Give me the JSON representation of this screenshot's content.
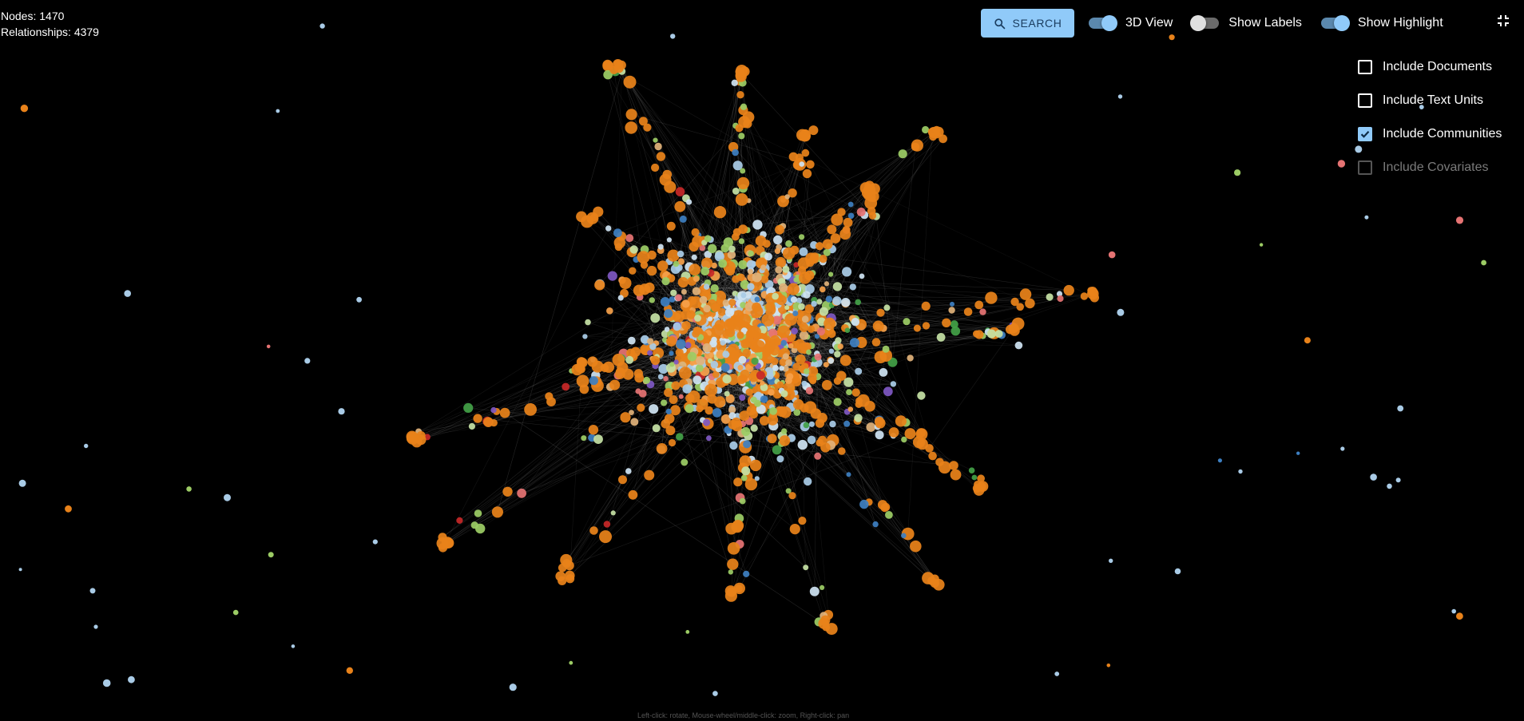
{
  "stats": {
    "nodes_label": "Nodes: 1470",
    "relationships_label": "Relationships: 4379"
  },
  "toolbar": {
    "search_label": "SEARCH",
    "toggles": [
      {
        "label": "3D View",
        "on": true
      },
      {
        "label": "Show Labels",
        "on": false
      },
      {
        "label": "Show Highlight",
        "on": true
      }
    ]
  },
  "filters": [
    {
      "label": "Include Documents",
      "checked": false,
      "enabled": true
    },
    {
      "label": "Include Text Units",
      "checked": false,
      "enabled": true
    },
    {
      "label": "Include Communities",
      "checked": true,
      "enabled": true
    },
    {
      "label": "Include Covariates",
      "checked": false,
      "enabled": false
    }
  ],
  "hint_text": "Left-click: rotate, Mouse-wheel/middle-click: zoom, Right-click: pan",
  "colors": {
    "accent": "#90caf9",
    "background": "#000000",
    "node_palette": [
      "#e8821a",
      "#f5a04a",
      "#a9cbe6",
      "#cfe3f2",
      "#9ccc65",
      "#c5e1a5",
      "#3d7fc1",
      "#e57373",
      "#7e57c2",
      "#43a047",
      "#c62828",
      "#e0b27a"
    ]
  }
}
